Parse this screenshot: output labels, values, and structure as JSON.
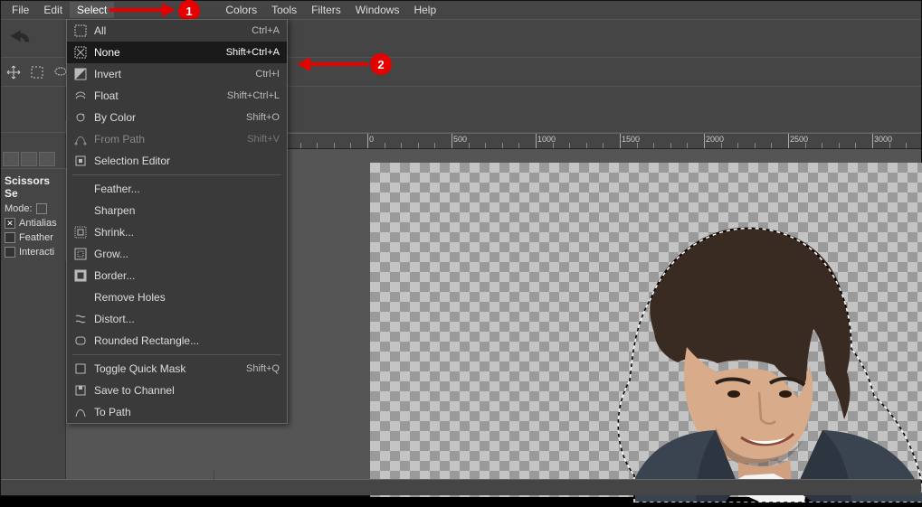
{
  "menubar": {
    "items": [
      "File",
      "Edit",
      "Select",
      "",
      "Colors",
      "Tools",
      "Filters",
      "Windows",
      "Help"
    ],
    "open_index": 2
  },
  "dropdown": {
    "groups": [
      [
        {
          "label": "All",
          "accel": "Ctrl+A",
          "icon": "select-all-icon"
        },
        {
          "label": "None",
          "accel": "Shift+Ctrl+A",
          "icon": "select-none-icon",
          "highlight": true
        },
        {
          "label": "Invert",
          "accel": "Ctrl+I",
          "icon": "invert-icon"
        },
        {
          "label": "Float",
          "accel": "Shift+Ctrl+L",
          "icon": "float-icon"
        },
        {
          "label": "By Color",
          "accel": "Shift+O",
          "icon": "by-color-icon"
        },
        {
          "label": "From Path",
          "accel": "Shift+V",
          "icon": "from-path-icon",
          "disabled": true
        },
        {
          "label": "Selection Editor",
          "accel": "",
          "icon": "editor-icon"
        }
      ],
      [
        {
          "label": "Feather...",
          "accel": "",
          "icon": ""
        },
        {
          "label": "Sharpen",
          "accel": "",
          "icon": ""
        },
        {
          "label": "Shrink...",
          "accel": "",
          "icon": "shrink-icon"
        },
        {
          "label": "Grow...",
          "accel": "",
          "icon": "grow-icon"
        },
        {
          "label": "Border...",
          "accel": "",
          "icon": "border-icon"
        },
        {
          "label": "Remove Holes",
          "accel": "",
          "icon": ""
        },
        {
          "label": "Distort...",
          "accel": "",
          "icon": "distort-icon"
        },
        {
          "label": "Rounded Rectangle...",
          "accel": "",
          "icon": "rounded-icon"
        }
      ],
      [
        {
          "label": "Toggle Quick Mask",
          "accel": "Shift+Q",
          "icon": "checkbox-icon"
        },
        {
          "label": "Save to Channel",
          "accel": "",
          "icon": "save-channel-icon"
        },
        {
          "label": "To Path",
          "accel": "",
          "icon": "to-path-icon"
        }
      ]
    ]
  },
  "tool_options": {
    "title": "Scissors Se",
    "mode_label": "Mode:",
    "antialias": "Antialias",
    "feather": "Feather",
    "interactive": "Interacti"
  },
  "ruler": {
    "ticks": [
      0,
      500,
      1000,
      1500,
      2000,
      2500,
      3000
    ]
  },
  "annotations": {
    "a1": "1",
    "a2": "2"
  }
}
